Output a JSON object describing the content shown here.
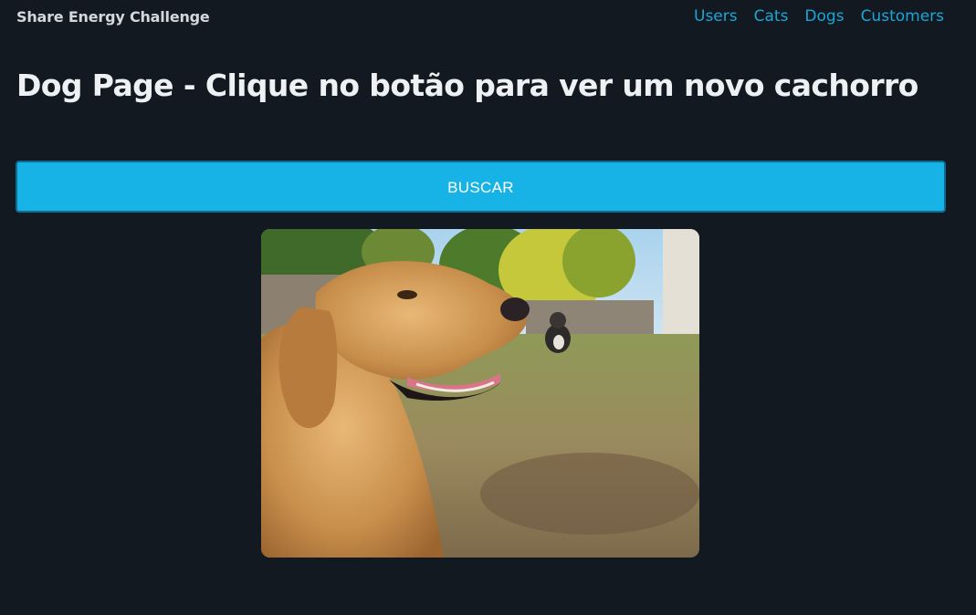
{
  "navbar": {
    "brand": "Share Energy Challenge",
    "links": [
      {
        "label": "Users"
      },
      {
        "label": "Cats"
      },
      {
        "label": "Dogs"
      },
      {
        "label": "Customers"
      }
    ]
  },
  "page": {
    "title": "Dog Page - Clique no botão para ver um novo cachorro",
    "button_label": "BUSCAR"
  },
  "colors": {
    "background": "#131920",
    "link": "#1ba6d8",
    "button": "#17b3e6"
  }
}
